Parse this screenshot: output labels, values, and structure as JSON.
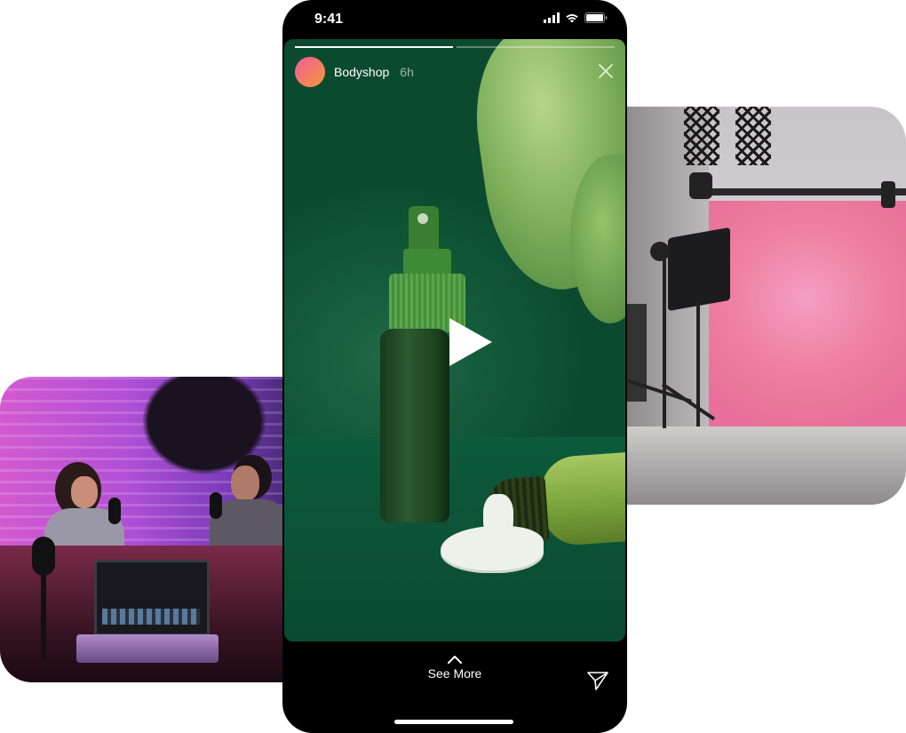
{
  "status_bar": {
    "time": "9:41",
    "icons": [
      "signal-icon",
      "wifi-icon",
      "battery-icon"
    ]
  },
  "story": {
    "username": "Bodyshop",
    "time_ago": "6h",
    "progress": [
      1.0,
      0.0
    ],
    "play_icon": "play-icon",
    "close_icon": "close-icon"
  },
  "footer": {
    "see_more_label": "See More",
    "chevron_icon": "chevron-up-icon",
    "send_icon": "send-icon"
  },
  "side_images": {
    "left": "podcast-studio-photo",
    "right": "photo-studio-photo"
  },
  "colors": {
    "avatar_start": "#f25a9a",
    "avatar_end": "#f39a3a",
    "story_background": "#135a3a"
  }
}
